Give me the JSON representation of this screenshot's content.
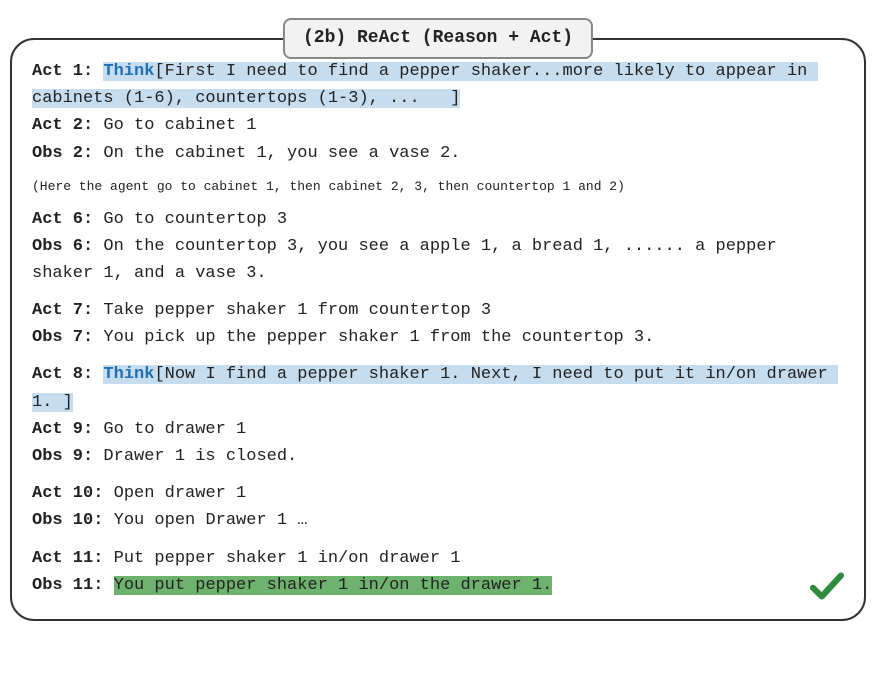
{
  "title": "(2b) ReAct (Reason + Act)",
  "act1_label": "Act 1:",
  "think1_kw": "Think",
  "think1_body": "[First I need to find a pepper shaker...more likely to appear in cabinets (1-6), countertops (1-3), ...   ]",
  "act2_label": "Act 2:",
  "act2_text": " Go to cabinet 1",
  "obs2_label": "Obs 2:",
  "obs2_text": " On the cabinet 1, you see a vase 2.",
  "note": "(Here the agent go to cabinet 1, then cabinet 2, 3, then countertop 1 and 2)",
  "act6_label": "Act 6:",
  "act6_text": " Go to countertop 3",
  "obs6_label": "Obs 6:",
  "obs6_text": " On the countertop 3, you see a apple 1, a bread 1, ...... a pepper shaker 1, and a vase 3.",
  "act7_label": "Act 7:",
  "act7_text": " Take pepper shaker 1 from countertop 3",
  "obs7_label": "Obs 7:",
  "obs7_text": " You pick up the pepper shaker 1 from the countertop 3.",
  "act8_label": "Act 8:",
  "think8_kw": "Think",
  "think8_body": "[Now I find a pepper shaker 1. Next, I need to put it in/on drawer 1. ]",
  "act9_label": "Act 9:",
  "act9_text": " Go to drawer 1",
  "obs9_label": "Obs 9:",
  "obs9_text": " Drawer 1 is closed.",
  "act10_label": "Act 10:",
  "act10_text": " Open drawer 1",
  "obs10_label": "Obs 10:",
  "obs10_text": " You open Drawer 1 …",
  "act11_label": "Act 11:",
  "act11_text": " Put pepper shaker 1 in/on drawer 1",
  "obs11_label": "Obs 11:",
  "obs11_text": "You put pepper shaker 1 in/on the drawer 1.",
  "check_icon": "checkmark"
}
